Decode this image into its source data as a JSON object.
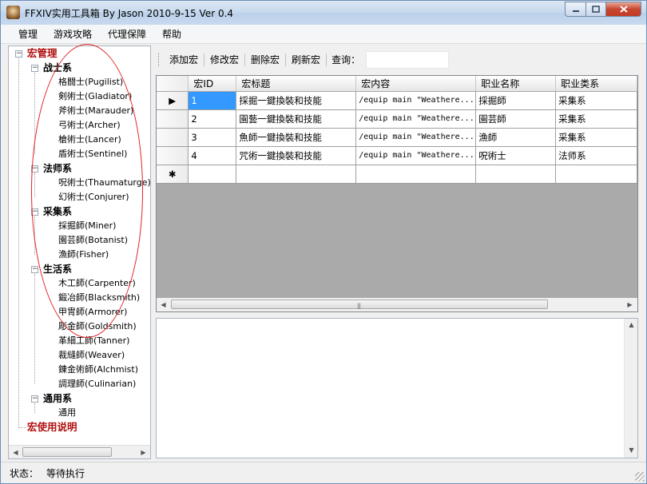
{
  "window": {
    "title": "FFXIV实用工具箱 By Jason 2010-9-15 Ver 0.4",
    "min_icon": "minimize-icon",
    "max_icon": "maximize-icon",
    "close_icon": "close-icon"
  },
  "menu": {
    "items": [
      "管理",
      "游戏攻略",
      "代理保障",
      "帮助"
    ]
  },
  "tree": {
    "root1": "宏管理",
    "groups": [
      {
        "label": "战士系",
        "children": [
          "格闘士(Pugilist)",
          "剣術士(Gladiator)",
          "斧術士(Marauder)",
          "弓術士(Archer)",
          "槍術士(Lancer)",
          "盾術士(Sentinel)"
        ]
      },
      {
        "label": "法师系",
        "children": [
          "呪術士(Thaumaturge)",
          "幻術士(Conjurer)"
        ]
      },
      {
        "label": "采集系",
        "children": [
          "採掘師(Miner)",
          "園芸師(Botanist)",
          "漁師(Fisher)"
        ]
      },
      {
        "label": "生活系",
        "children": [
          "木工師(Carpenter)",
          "鍛冶師(Blacksmith)",
          "甲冑師(Armorer)",
          "彫金師(Goldsmith)",
          "革細工師(Tanner)",
          "裁縫師(Weaver)",
          "錬金術師(Alchmist)",
          "調理師(Culinarian)"
        ]
      },
      {
        "label": "通用系",
        "children": [
          "通用"
        ]
      }
    ],
    "root2": "宏使用说明"
  },
  "toolbar": {
    "add": "添加宏",
    "edit": "修改宏",
    "delete": "删除宏",
    "refresh": "刷新宏",
    "search_label": "查询：",
    "search_value": ""
  },
  "grid": {
    "columns": [
      "宏ID",
      "宏标题",
      "宏内容",
      "职业名称",
      "职业类系"
    ],
    "rows": [
      [
        "1",
        "採掘一鍵換裝和技能",
        "/equip main \"Weathere...",
        "採掘師",
        "采集系"
      ],
      [
        "2",
        "園藝一鍵換裝和技能",
        "/equip main \"Weathere...",
        "園芸師",
        "采集系"
      ],
      [
        "3",
        "魚師一鍵換裝和技能",
        "/equip main \"Weathere...",
        "漁師",
        "采集系"
      ],
      [
        "4",
        "咒術一鍵換裝和技能",
        "/equip main \"Weathere...",
        "呪術士",
        "法师系"
      ]
    ],
    "current_row_glyph": "▶",
    "new_row_glyph": "✱"
  },
  "status": {
    "label": "状态：",
    "value": "等待执行"
  }
}
